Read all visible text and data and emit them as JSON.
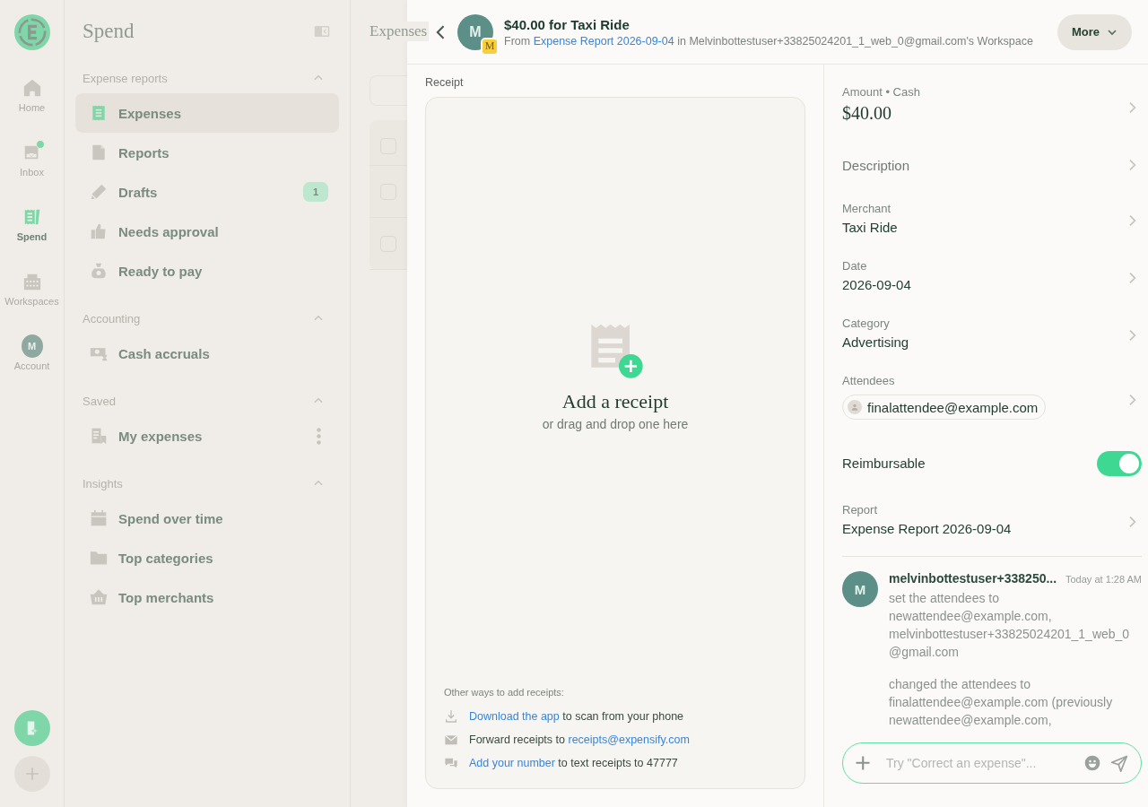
{
  "rail": {
    "items": [
      {
        "kind": "home",
        "label": "Home",
        "selected": false,
        "dot": false
      },
      {
        "kind": "inbox",
        "label": "Inbox",
        "selected": false,
        "dot": true
      },
      {
        "kind": "spend",
        "label": "Spend",
        "selected": true,
        "dot": false
      },
      {
        "kind": "workspaces",
        "label": "Workspaces",
        "selected": false,
        "dot": false
      },
      {
        "kind": "avatar",
        "label": "Account",
        "initial": "M",
        "selected": false,
        "dot": false
      }
    ]
  },
  "sidebar": {
    "title": "Spend",
    "sections": [
      {
        "title": "Expense reports",
        "expanded": true,
        "items": [
          {
            "kind": "receipt",
            "label": "Expenses",
            "selected": true
          },
          {
            "kind": "document",
            "label": "Reports",
            "selected": false
          },
          {
            "kind": "pencil",
            "label": "Drafts",
            "selected": false,
            "badge": "1"
          },
          {
            "kind": "thumb",
            "label": "Needs approval",
            "selected": false
          },
          {
            "kind": "moneybag",
            "label": "Ready to pay",
            "selected": false
          }
        ]
      },
      {
        "title": "Accounting",
        "expanded": true,
        "items": [
          {
            "kind": "cash",
            "label": "Cash accruals",
            "selected": false
          }
        ]
      },
      {
        "title": "Saved",
        "expanded": true,
        "items": [
          {
            "kind": "bookmark",
            "label": "My expenses",
            "selected": false,
            "menu": true
          }
        ]
      },
      {
        "title": "Insights",
        "expanded": true,
        "items": [
          {
            "kind": "calendar",
            "label": "Spend over time",
            "selected": false
          },
          {
            "kind": "folder",
            "label": "Top categories",
            "selected": false
          },
          {
            "kind": "basket",
            "label": "Top merchants",
            "selected": false
          }
        ]
      }
    ]
  },
  "main": {
    "title": "Expenses",
    "select_all": {
      "checked": false
    },
    "rows": [
      {
        "checked": false
      },
      {
        "checked": false
      }
    ]
  },
  "expense": {
    "title": "$40.00 for Taxi Ride",
    "avatar": "M",
    "badge": "M",
    "subtitle": [
      {
        "text": "From ",
        "link": false
      },
      {
        "text": "Expense Report 2026-09-04",
        "link": true
      },
      {
        "text": " in Melvinbottestuser+33825024201_1_web_0@gmail.com's Workspace",
        "link": false
      }
    ],
    "more": "More"
  },
  "receipt": {
    "label": "Receipt",
    "title": "Add a receipt",
    "hint": "or drag and drop one here",
    "other_title": "Other ways to add receipts:",
    "options": [
      {
        "kind": "download",
        "parts": [
          {
            "text": "Download the app",
            "link": true
          },
          {
            "text": " to scan from your phone",
            "link": false
          }
        ]
      },
      {
        "kind": "mail",
        "parts": [
          {
            "text": "Forward receipts to ",
            "link": false
          },
          {
            "text": "receipts@expensify.com",
            "link": true
          }
        ]
      },
      {
        "kind": "chat",
        "parts": [
          {
            "text": "Add your number",
            "link": true
          },
          {
            "text": " to text receipts to 47777",
            "link": false
          }
        ]
      }
    ]
  },
  "fields": [
    {
      "kind": "amount",
      "label": "Amount • Cash",
      "value": "$40.00"
    },
    {
      "kind": "text",
      "label": "Description"
    },
    {
      "kind": "text",
      "label": "Merchant",
      "value": "Taxi Ride"
    },
    {
      "kind": "text",
      "label": "Date",
      "value": "2026-09-04"
    },
    {
      "kind": "text",
      "label": "Category",
      "value": "Advertising"
    },
    {
      "kind": "chips",
      "label": "Attendees",
      "chips": [
        "finalattendee@example.com"
      ]
    },
    {
      "kind": "toggle",
      "label": "Reimbursable",
      "on": true
    },
    {
      "kind": "text",
      "label": "Report",
      "value": "Expense Report 2026-09-04"
    }
  ],
  "comments": [
    {
      "avatar": "M",
      "author": "melvinbottestuser+338250...",
      "time": "Today at 1:28 AM",
      "messages": [
        "set the attendees to newattendee@example.com, melvinbottestuser+33825024201_1_web_0@gmail.com",
        "changed the attendees to finalattendee@example.com (previously newattendee@example.com,"
      ]
    }
  ],
  "composer": {
    "placeholder": "Try \"Correct an expense\"..."
  }
}
